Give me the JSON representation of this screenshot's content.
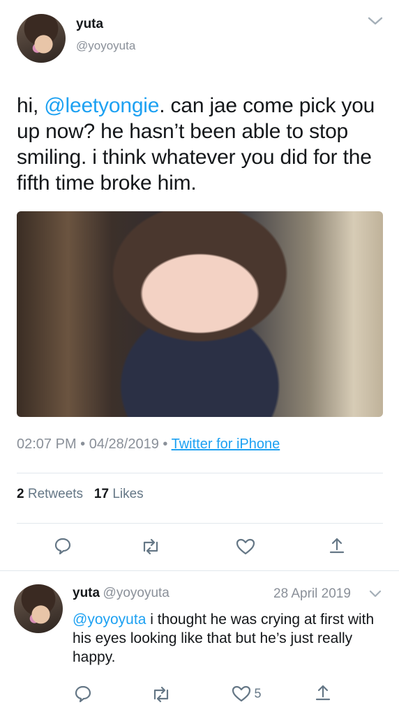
{
  "tweet": {
    "user_name": "yuta",
    "user_handle": "@yoyoyuta",
    "text_prefix": "hi, ",
    "mention": "@leetyongie",
    "text_suffix": ". can jae come pick you up now? he hasn’t been able to stop smiling. i think whatever you did for the fifth time broke him.",
    "time": "02:07 PM",
    "date": "04/28/2019",
    "source": "Twitter for iPhone",
    "retweet_count": "2",
    "retweet_label": "Retweets",
    "like_count": "17",
    "like_label": "Likes"
  },
  "reply": {
    "user_name": "yuta",
    "user_handle": "@yoyoyuta",
    "date": "28 April 2019",
    "mention": "@yoyoyuta",
    "text": " i thought he was crying at first with his eyes looking like that but he’s just really happy.",
    "like_count": "5"
  },
  "icons": [
    "reply-icon",
    "retweet-icon",
    "like-icon",
    "share-icon",
    "chevron-down-icon"
  ],
  "colors": {
    "accent": "#1da1f2",
    "muted": "#8a9099",
    "divider": "#e1e8ed"
  }
}
